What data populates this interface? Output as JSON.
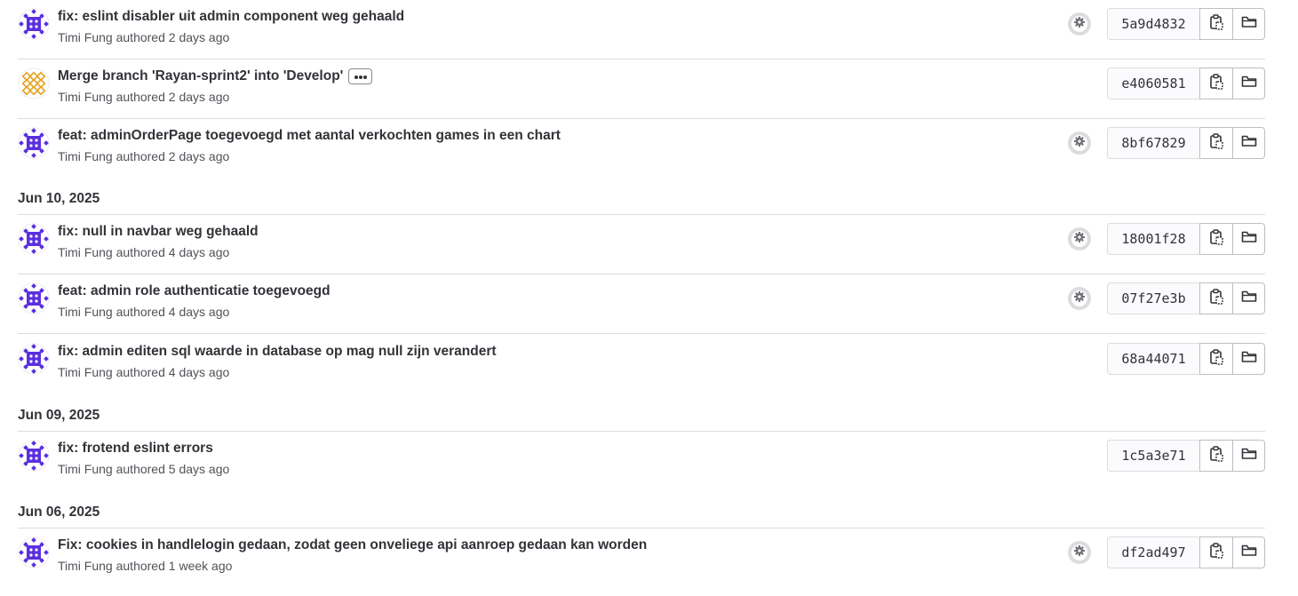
{
  "authored_word": "authored",
  "day_headers": [
    "Jun 10, 2025",
    "Jun 09, 2025",
    "Jun 06, 2025"
  ],
  "commits": [
    {
      "title": "fix: eslint disabler uit admin component weg gehaald",
      "author": "Timi Fung",
      "time": "2 days ago",
      "sha": "5a9d4832",
      "pipeline": true,
      "avatar": "purple"
    },
    {
      "title": "Merge branch 'Rayan-sprint2' into 'Develop'",
      "author": "Timi Fung",
      "time": "2 days ago",
      "sha": "e4060581",
      "pipeline": false,
      "avatar": "orange",
      "more": true
    },
    {
      "title": "feat: adminOrderPage toegevoegd met aantal verkochten games in een chart",
      "author": "Timi Fung",
      "time": "2 days ago",
      "sha": "8bf67829",
      "pipeline": true,
      "avatar": "purple"
    },
    {
      "title": "fix: null in navbar weg gehaald",
      "author": "Timi Fung",
      "time": "4 days ago",
      "sha": "18001f28",
      "pipeline": true,
      "avatar": "purple"
    },
    {
      "title": "feat: admin role authenticatie toegevoegd",
      "author": "Timi Fung",
      "time": "4 days ago",
      "sha": "07f27e3b",
      "pipeline": true,
      "avatar": "purple"
    },
    {
      "title": "fix: admin editen sql waarde in database op mag null zijn verandert",
      "author": "Timi Fung",
      "time": "4 days ago",
      "sha": "68a44071",
      "pipeline": false,
      "avatar": "purple"
    },
    {
      "title": "fix: frotend eslint errors",
      "author": "Timi Fung",
      "time": "5 days ago",
      "sha": "1c5a3e71",
      "pipeline": false,
      "avatar": "purple"
    },
    {
      "title": "Fix: cookies in handlelogin gedaan, zodat geen onveliege api aanroep gedaan kan worden",
      "author": "Timi Fung",
      "time": "1 week ago",
      "sha": "df2ad497",
      "pipeline": true,
      "avatar": "purple"
    }
  ],
  "colors": {
    "avatar_purple": "#5b2fe0",
    "avatar_orange": "#e5a01a",
    "border": "#dcdcde"
  },
  "icons": {
    "pipeline": "gear-icon",
    "copy": "copy-icon",
    "browse": "folder-icon",
    "more": "ellipsis-icon"
  }
}
